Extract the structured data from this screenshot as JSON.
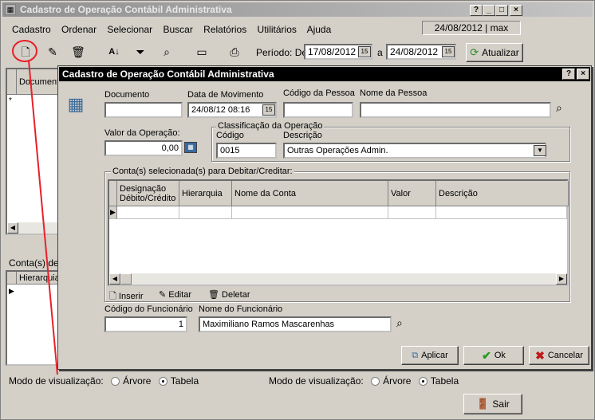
{
  "main_window": {
    "title": "Cadastro de Operação Contábil Administrativa",
    "menu": [
      "Cadastro",
      "Ordenar",
      "Selecionar",
      "Buscar",
      "Relatórios",
      "Utilitários",
      "Ajuda"
    ],
    "status": "24/08/2012 | max",
    "period_label": "Período: De",
    "date_from": "17/08/2012",
    "date_sep": "a",
    "date_to": "24/08/2012",
    "refresh_label": "Atualizar",
    "grid_header_doc": "Documento",
    "lower_label": "Conta(s) deb",
    "lower_grid_header": "Hierarquia",
    "view_mode_label": "Modo de visualização:",
    "view_tree": "Árvore",
    "view_table": "Tabela",
    "exit_label": "Sair"
  },
  "dialog": {
    "title": "Cadastro de Operação Contábil Administrativa",
    "fields": {
      "documento_label": "Documento",
      "documento_value": "",
      "data_label": "Data de Movimento",
      "data_value": "24/08/12 08:16",
      "codigo_pessoa_label": "Código da Pessoa",
      "codigo_pessoa_value": "",
      "nome_pessoa_label": "Nome da Pessoa",
      "nome_pessoa_value": "",
      "valor_label": "Valor da Operação:",
      "valor_value": "0,00"
    },
    "classificacao": {
      "legend": "Classificação da Operação",
      "codigo_label": "Código",
      "codigo_value": "0015",
      "descricao_label": "Descrição",
      "descricao_value": "Outras Operações Admin."
    },
    "contas": {
      "legend": "Conta(s) selecionada(s) para Debitar/Creditar:",
      "columns": [
        "Designação Débito/Crédito",
        "Hierarquia",
        "Nome da Conta",
        "Valor",
        "Descrição"
      ],
      "inserir": "Inserir",
      "editar": "Editar",
      "deletar": "Deletar"
    },
    "funcionario": {
      "codigo_label": "Código do Funcionário",
      "codigo_value": "1",
      "nome_label": "Nome do Funcionário",
      "nome_value": "Maximiliano Ramos Mascarenhas"
    },
    "view_mode_label": "Modo de visualização:",
    "view_tree": "Árvore",
    "view_table": "Tabela",
    "buttons": {
      "aplicar": "Aplicar",
      "ok": "Ok",
      "cancelar": "Cancelar"
    }
  },
  "colors": {
    "annotation": "#e8202a"
  }
}
